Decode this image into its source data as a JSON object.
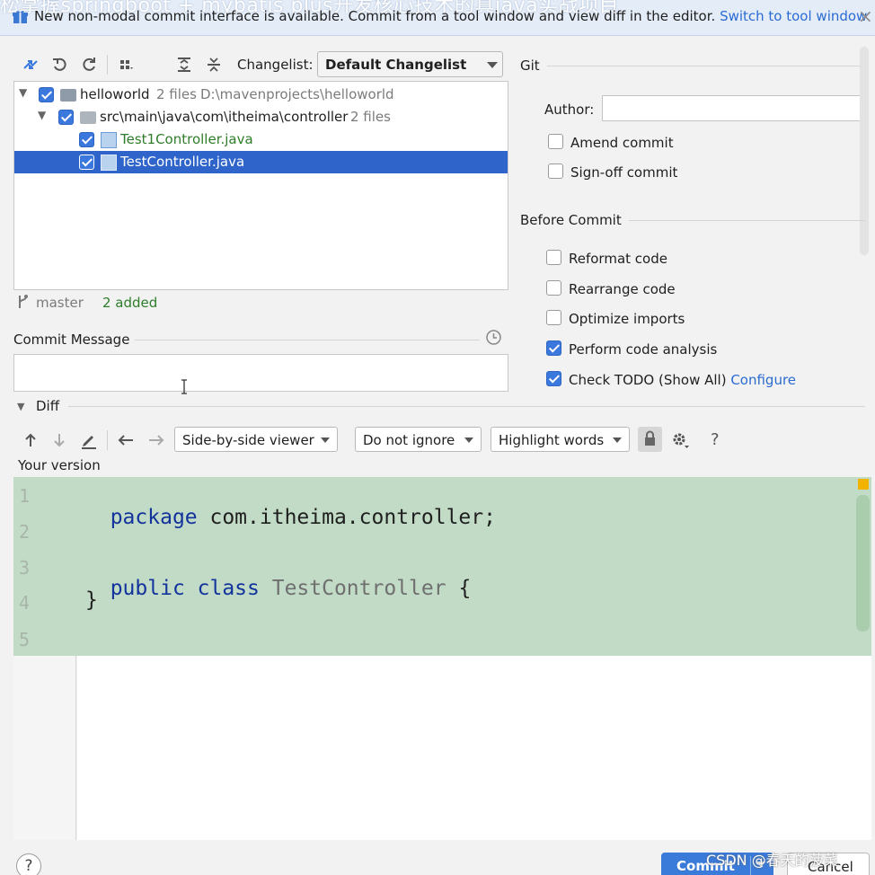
{
  "banner": {
    "overlay_text": "松掌握springboot + mybatis plus开发核心技术的真java实战项目",
    "message": "New non-modal commit interface is available. Commit from a tool window and view diff in the editor.",
    "link": "Switch to tool window",
    "close": "×"
  },
  "toolbar": {
    "changelist_label": "Changelist:",
    "changelist_value": "Default Changelist"
  },
  "tree": {
    "root": {
      "name": "helloworld",
      "count": "2 files",
      "path": "D:\\mavenprojects\\helloworld"
    },
    "folder": {
      "name": "src\\main\\java\\com\\itheima\\controller",
      "count": "2 files"
    },
    "files": [
      "Test1Controller.java",
      "TestController.java"
    ]
  },
  "status": {
    "branch": "master",
    "added": "2 added"
  },
  "commit_message": {
    "label": "Commit Message",
    "value": ""
  },
  "git": {
    "title": "Git",
    "author_label": "Author:",
    "author_value": "",
    "amend": "Amend commit",
    "signoff": "Sign-off commit"
  },
  "before_commit": {
    "title": "Before Commit",
    "reformat": "Reformat code",
    "rearrange": "Rearrange code",
    "optimize": "Optimize imports",
    "analysis": "Perform code analysis",
    "todo": "Check TODO (Show All)",
    "configure": "Configure"
  },
  "diff": {
    "title": "Diff",
    "viewer": "Side-by-side viewer",
    "ignore": "Do not ignore",
    "highlight": "Highlight words",
    "help": "?",
    "your_version": "Your version",
    "lines": [
      "1",
      "2",
      "3",
      "4",
      "5"
    ],
    "code": {
      "l1_kw": "package",
      "l1_rest": " com.itheima.controller;",
      "l3_kw": "public class",
      "l3_cls": " TestController",
      "l3_rest": " {",
      "l4": "}"
    }
  },
  "footer": {
    "help": "?",
    "commit": "Commit",
    "cancel": "Cancel",
    "watermark": "CSDN @春天的菠菜"
  }
}
